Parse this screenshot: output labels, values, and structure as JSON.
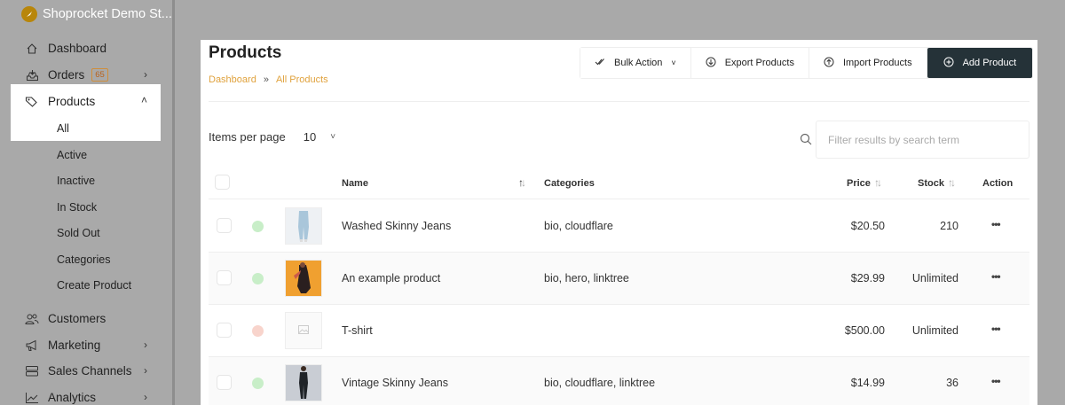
{
  "sidebar": {
    "store_name": "Shoprocket Demo St...",
    "nav": {
      "dashboard": "Dashboard",
      "orders": "Orders",
      "orders_badge": "65",
      "products": "Products",
      "customers": "Customers",
      "marketing": "Marketing",
      "sales_channels": "Sales Channels",
      "analytics": "Analytics"
    },
    "product_sub": {
      "all": "All",
      "active": "Active",
      "inactive": "Inactive",
      "in_stock": "In Stock",
      "sold_out": "Sold Out",
      "categories": "Categories",
      "create": "Create Product"
    }
  },
  "main": {
    "title": "Products",
    "breadcrumb": {
      "home": "Dashboard",
      "sep": "»",
      "current": "All Products"
    },
    "toolbar": {
      "bulk": "Bulk Action",
      "export": "Export Products",
      "import": "Import Products",
      "add": "Add Product"
    },
    "items_per_page_label": "Items per page",
    "items_per_page_value": "10",
    "search_placeholder": "Filter results by search term",
    "columns": {
      "name": "Name",
      "categories": "Categories",
      "price": "Price",
      "stock": "Stock",
      "action": "Action"
    },
    "rows": [
      {
        "name": "Washed Skinny Jeans",
        "categories": "bio, cloudflare",
        "price": "$20.50",
        "stock": "210",
        "status_color": "#c8eec8"
      },
      {
        "name": "An example product",
        "categories": "bio, hero, linktree",
        "price": "$29.99",
        "stock": "Unlimited",
        "status_color": "#c8eec8"
      },
      {
        "name": "T-shirt",
        "categories": "",
        "price": "$500.00",
        "stock": "Unlimited",
        "status_color": "#f8d4cc"
      },
      {
        "name": "Vintage Skinny Jeans",
        "categories": "bio, cloudflare, linktree",
        "price": "$14.99",
        "stock": "36",
        "status_color": "#c8eec8"
      }
    ]
  }
}
